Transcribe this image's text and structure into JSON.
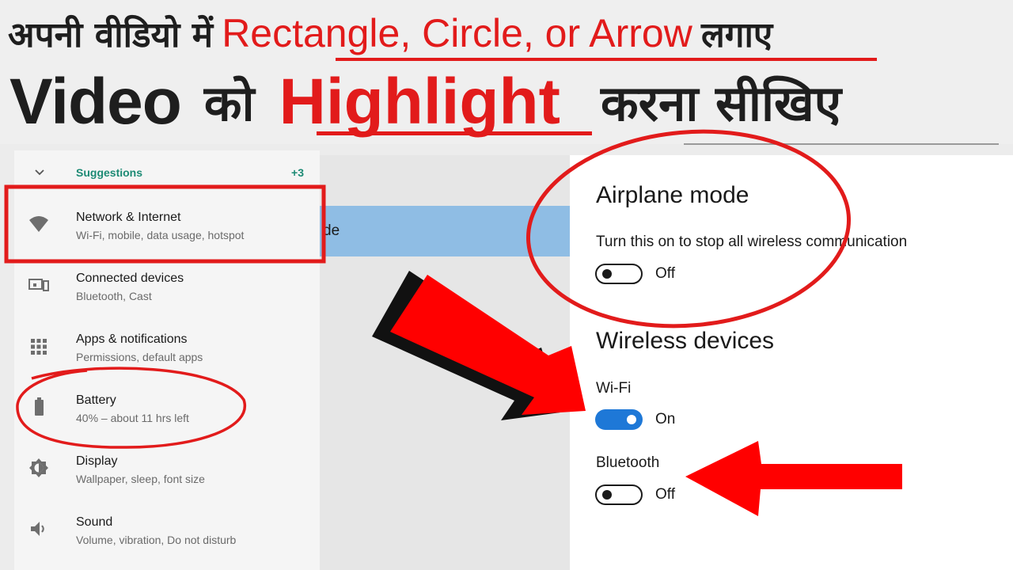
{
  "banner": {
    "line1_hindi_a": "अपनी वीडियो में",
    "line1_red": "Rectangle, Circle, or Arrow",
    "line1_hindi_b": "लगाए",
    "line2_video": "Video",
    "line2_ko": "को",
    "line2_red": "Highlight",
    "line2_hindi": "करना सीखिए"
  },
  "settings": {
    "suggestions_label": "Suggestions",
    "suggestions_count": "+3",
    "items": [
      {
        "title": "Network & Internet",
        "subtitle": "Wi-Fi, mobile, data usage, hotspot",
        "icon": "wifi-icon"
      },
      {
        "title": "Connected devices",
        "subtitle": "Bluetooth, Cast",
        "icon": "devices-icon"
      },
      {
        "title": "Apps & notifications",
        "subtitle": "Permissions, default apps",
        "icon": "apps-grid-icon"
      },
      {
        "title": "Battery",
        "subtitle": "40% – about 11 hrs left",
        "icon": "battery-icon"
      },
      {
        "title": "Display",
        "subtitle": "Wallpaper, sleep, font size",
        "icon": "brightness-icon"
      },
      {
        "title": "Sound",
        "subtitle": "Volume, vibration, Do not disturb",
        "icon": "volume-icon"
      }
    ]
  },
  "middle": {
    "selected_fragment": "de"
  },
  "airplane": {
    "title": "Airplane mode",
    "description": "Turn this on to stop all wireless communication",
    "airplane_state": "Off",
    "wireless_title": "Wireless devices",
    "wifi_label": "Wi-Fi",
    "wifi_state": "On",
    "bluetooth_label": "Bluetooth",
    "bluetooth_state": "Off"
  },
  "colors": {
    "highlight_red": "#e21b1b",
    "accent_teal": "#1c8a74",
    "toggle_blue": "#1e78d7",
    "selection_blue": "#8fbde4"
  }
}
